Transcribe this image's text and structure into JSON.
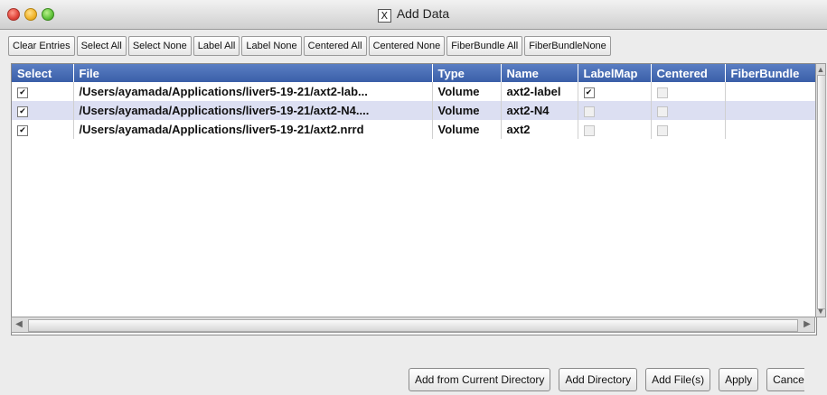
{
  "window": {
    "title": "Add Data",
    "icon": "x-icon"
  },
  "toolbar": {
    "buttons": [
      "Clear Entries",
      "Select All",
      "Select None",
      "Label All",
      "Label None",
      "Centered All",
      "Centered None",
      "FiberBundle All",
      "FiberBundleNone"
    ]
  },
  "table": {
    "columns": [
      "Select",
      "File",
      "Type",
      "Name",
      "LabelMap",
      "Centered",
      "FiberBundle"
    ],
    "rows": [
      {
        "select": true,
        "file": "/Users/ayamada/Applications/liver5-19-21/axt2-lab...",
        "type": "Volume",
        "name": "axt2-label",
        "labelmap": true,
        "centered": false
      },
      {
        "select": true,
        "file": "/Users/ayamada/Applications/liver5-19-21/axt2-N4....",
        "type": "Volume",
        "name": "axt2-N4",
        "labelmap": false,
        "centered": false
      },
      {
        "select": true,
        "file": "/Users/ayamada/Applications/liver5-19-21/axt2.nrrd",
        "type": "Volume",
        "name": "axt2",
        "labelmap": false,
        "centered": false
      }
    ]
  },
  "bottom": {
    "add_current_dir": "Add from Current Directory",
    "add_directory": "Add Directory",
    "add_files": "Add File(s)",
    "apply": "Apply",
    "cancel": "Cance"
  },
  "colors": {
    "header": "#3a5fa8",
    "alt_row": "#dcdff2"
  }
}
